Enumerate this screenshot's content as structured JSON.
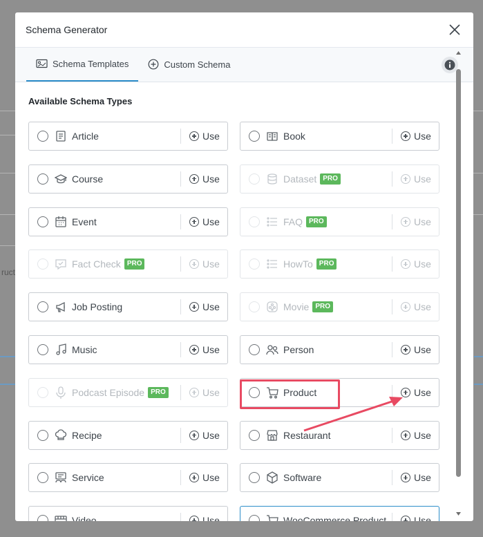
{
  "modal": {
    "title": "Schema Generator"
  },
  "tabs": [
    {
      "label": "Schema Templates",
      "active": true
    },
    {
      "label": "Custom Schema",
      "active": false
    }
  ],
  "background_fragment_text": "ruct",
  "section_title": "Available Schema Types",
  "use_label": "Use",
  "pro_label": "PRO",
  "schemas": [
    {
      "label": "Article",
      "icon": "article-icon",
      "pro": false
    },
    {
      "label": "Book",
      "icon": "book-icon",
      "pro": false
    },
    {
      "label": "Course",
      "icon": "graduation-cap-icon",
      "pro": false
    },
    {
      "label": "Dataset",
      "icon": "database-icon",
      "pro": true
    },
    {
      "label": "Event",
      "icon": "calendar-icon",
      "pro": false
    },
    {
      "label": "FAQ",
      "icon": "list-icon",
      "pro": true
    },
    {
      "label": "Fact Check",
      "icon": "fact-check-icon",
      "pro": true
    },
    {
      "label": "HowTo",
      "icon": "list-icon",
      "pro": true
    },
    {
      "label": "Job Posting",
      "icon": "megaphone-icon",
      "pro": false
    },
    {
      "label": "Movie",
      "icon": "film-reel-icon",
      "pro": true
    },
    {
      "label": "Music",
      "icon": "music-note-icon",
      "pro": false
    },
    {
      "label": "Person",
      "icon": "people-icon",
      "pro": false
    },
    {
      "label": "Podcast Episode",
      "icon": "microphone-icon",
      "pro": true
    },
    {
      "label": "Product",
      "icon": "cart-icon",
      "pro": false
    },
    {
      "label": "Recipe",
      "icon": "chef-hat-icon",
      "pro": false
    },
    {
      "label": "Restaurant",
      "icon": "storefront-icon",
      "pro": false
    },
    {
      "label": "Service",
      "icon": "service-icon",
      "pro": false
    },
    {
      "label": "Software",
      "icon": "box-icon",
      "pro": false
    },
    {
      "label": "Video",
      "icon": "video-icon",
      "pro": false
    },
    {
      "label": "WooCommerce Product",
      "icon": "cart-icon",
      "pro": false
    }
  ],
  "colors": {
    "accent": "#2c8dc9",
    "pro_badge": "#5cb85c",
    "annotation": "#e84a62"
  }
}
